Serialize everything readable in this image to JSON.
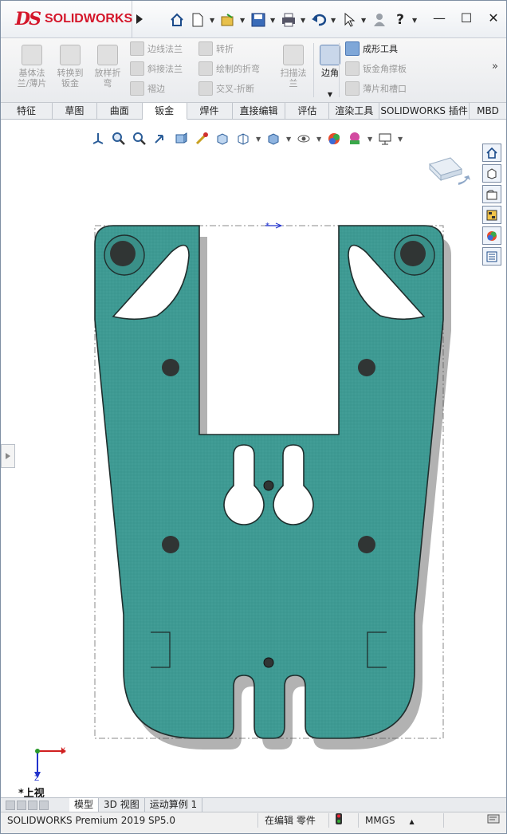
{
  "app": {
    "logo_ds": "DS",
    "logo_text": "SOLIDWORKS"
  },
  "titlebar": {
    "icons": [
      "home-icon",
      "new-document-icon",
      "open-icon",
      "save-icon",
      "print-icon",
      "undo-icon",
      "select-icon",
      "user-icon",
      "help-icon"
    ],
    "window_controls": [
      "minimize-icon",
      "maximize-icon",
      "close-icon"
    ]
  },
  "ribbon": {
    "big_buttons": [
      {
        "label": "基体法\n兰/薄片",
        "enabled": false
      },
      {
        "label": "转换到\n钣金",
        "enabled": false
      },
      {
        "label": "放样折\n弯",
        "enabled": false
      }
    ],
    "col1": [
      {
        "label": "边线法兰",
        "enabled": false
      },
      {
        "label": "斜接法兰",
        "enabled": false
      },
      {
        "label": "褶边",
        "enabled": false
      }
    ],
    "col2": [
      {
        "label": "转折",
        "enabled": false
      },
      {
        "label": "绘制的折弯",
        "enabled": false
      },
      {
        "label": "交叉-折断",
        "enabled": false
      }
    ],
    "sweep": {
      "label": "扫描法\n兰",
      "enabled": false
    },
    "corner": {
      "label": "边角",
      "enabled": true
    },
    "col3": [
      {
        "label": "成形工具",
        "enabled": true
      },
      {
        "label": "钣金角撑板",
        "enabled": false
      },
      {
        "label": "薄片和槽口",
        "enabled": false
      }
    ],
    "more": "»"
  },
  "tabs": [
    {
      "label": "特征",
      "active": false
    },
    {
      "label": "草图",
      "active": false
    },
    {
      "label": "曲面",
      "active": false
    },
    {
      "label": "钣金",
      "active": true
    },
    {
      "label": "焊件",
      "active": false
    },
    {
      "label": "直接编辑",
      "active": false
    },
    {
      "label": "评估",
      "active": false
    },
    {
      "label": "渲染工具",
      "active": false
    },
    {
      "label": "SOLIDWORKS 插件",
      "active": false
    },
    {
      "label": "MBD",
      "active": false
    }
  ],
  "viewport": {
    "view_label": "*上视",
    "part_color": "#3e9a93",
    "triad": {
      "x": "X",
      "z": "Z"
    }
  },
  "bottom_tabs": [
    {
      "label": "模型",
      "active": true
    },
    {
      "label": "3D 视图",
      "active": false
    },
    {
      "label": "运动算例 1",
      "active": false
    }
  ],
  "status": {
    "version": "SOLIDWORKS Premium 2019 SP5.0",
    "mode": "在编辑 零件",
    "units": "MMGS",
    "units_arrow": "▲"
  }
}
